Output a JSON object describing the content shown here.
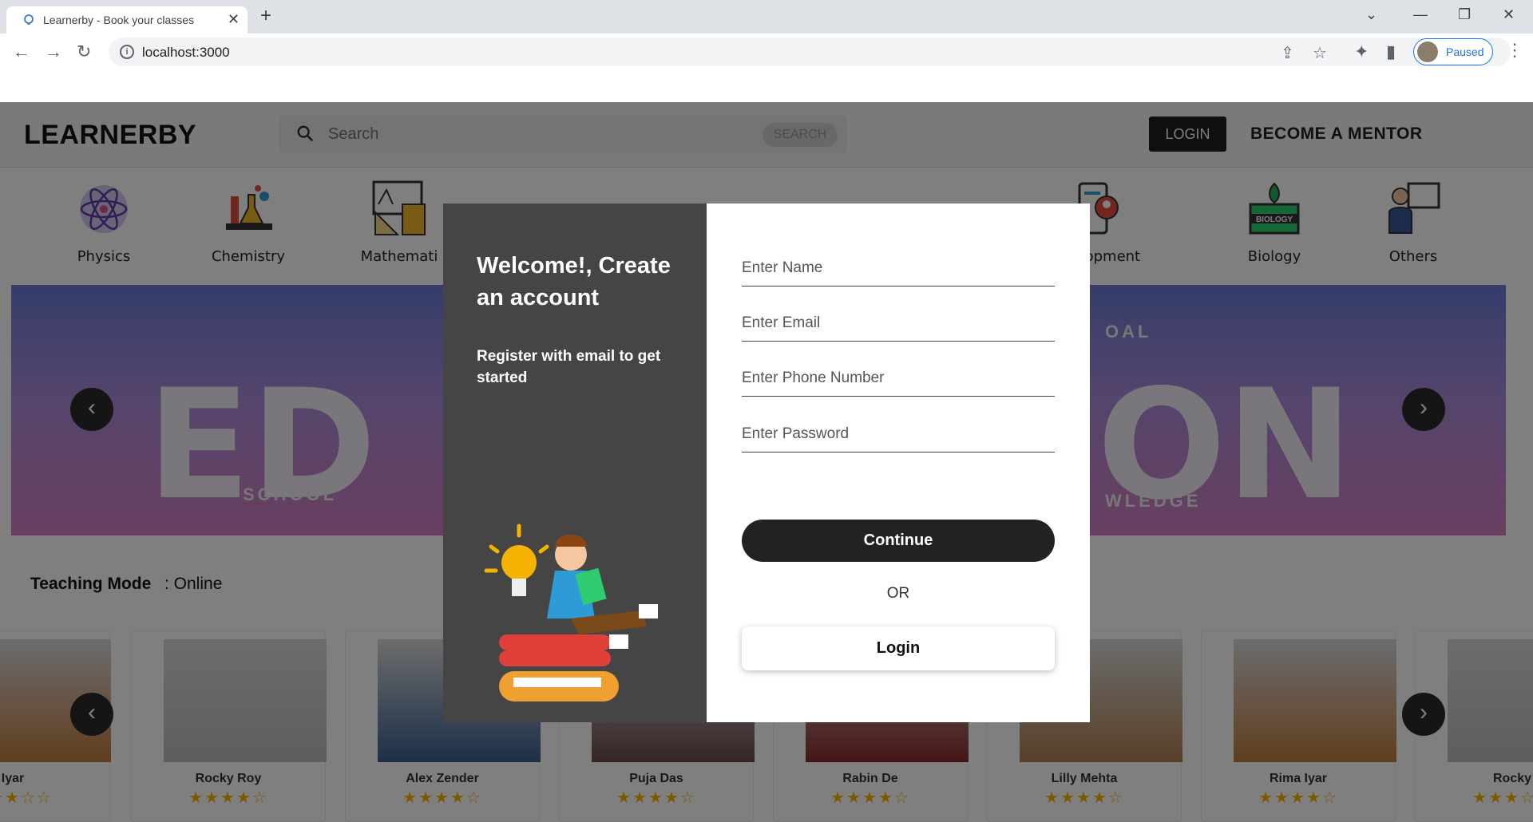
{
  "browser": {
    "tab_title": "Learnerby - Book your classes",
    "url": "localhost:3000",
    "profile_status": "Paused"
  },
  "header": {
    "logo": "LEARNERBY",
    "search_placeholder": "Search",
    "search_button": "SEARCH",
    "login": "LOGIN",
    "become_mentor": "BECOME A MENTOR"
  },
  "categories": [
    {
      "label": "Physics",
      "icon": "atom-icon"
    },
    {
      "label": "Chemistry",
      "icon": "flask-icon"
    },
    {
      "label": "Mathemati",
      "icon": "math-icon"
    },
    {
      "label": "",
      "icon": "cart-icon"
    },
    {
      "label": "",
      "icon": "book-icon"
    },
    {
      "label": "",
      "icon": "screen-icon"
    },
    {
      "label": "velopment",
      "icon": "development-icon"
    },
    {
      "label": "Biology",
      "icon": "biology-icon"
    },
    {
      "label": "Others",
      "icon": "teacher-icon"
    }
  ],
  "banner": {
    "word_left": "SCHOOL",
    "word_right": "WLEDGE",
    "word_top": "OAL"
  },
  "teaching_mode": {
    "label": "Teaching Mode",
    "value": ": Online"
  },
  "mentors": [
    {
      "name": "Iyar",
      "rating": 3
    },
    {
      "name": "Rocky Roy",
      "rating": 4
    },
    {
      "name": "Alex Zender",
      "rating": 4
    },
    {
      "name": "Puja Das",
      "rating": 4
    },
    {
      "name": "Rabin De",
      "rating": 4
    },
    {
      "name": "Lilly Mehta",
      "rating": 4
    },
    {
      "name": "Rima Iyar",
      "rating": 4
    },
    {
      "name": "Rocky",
      "rating": 3
    }
  ],
  "modal": {
    "welcome": "Welcome!, Create an account",
    "subtitle": "Register with email to get started",
    "name_placeholder": "Enter Name",
    "email_placeholder": "Enter Email",
    "phone_placeholder": "Enter Phone Number",
    "password_placeholder": "Enter Password",
    "continue": "Continue",
    "or": "OR",
    "login": "Login"
  },
  "colors": {
    "dark": "#222222",
    "modal_left": "#454545",
    "star": "#f5b301",
    "accent_blue": "#1a73e8"
  }
}
